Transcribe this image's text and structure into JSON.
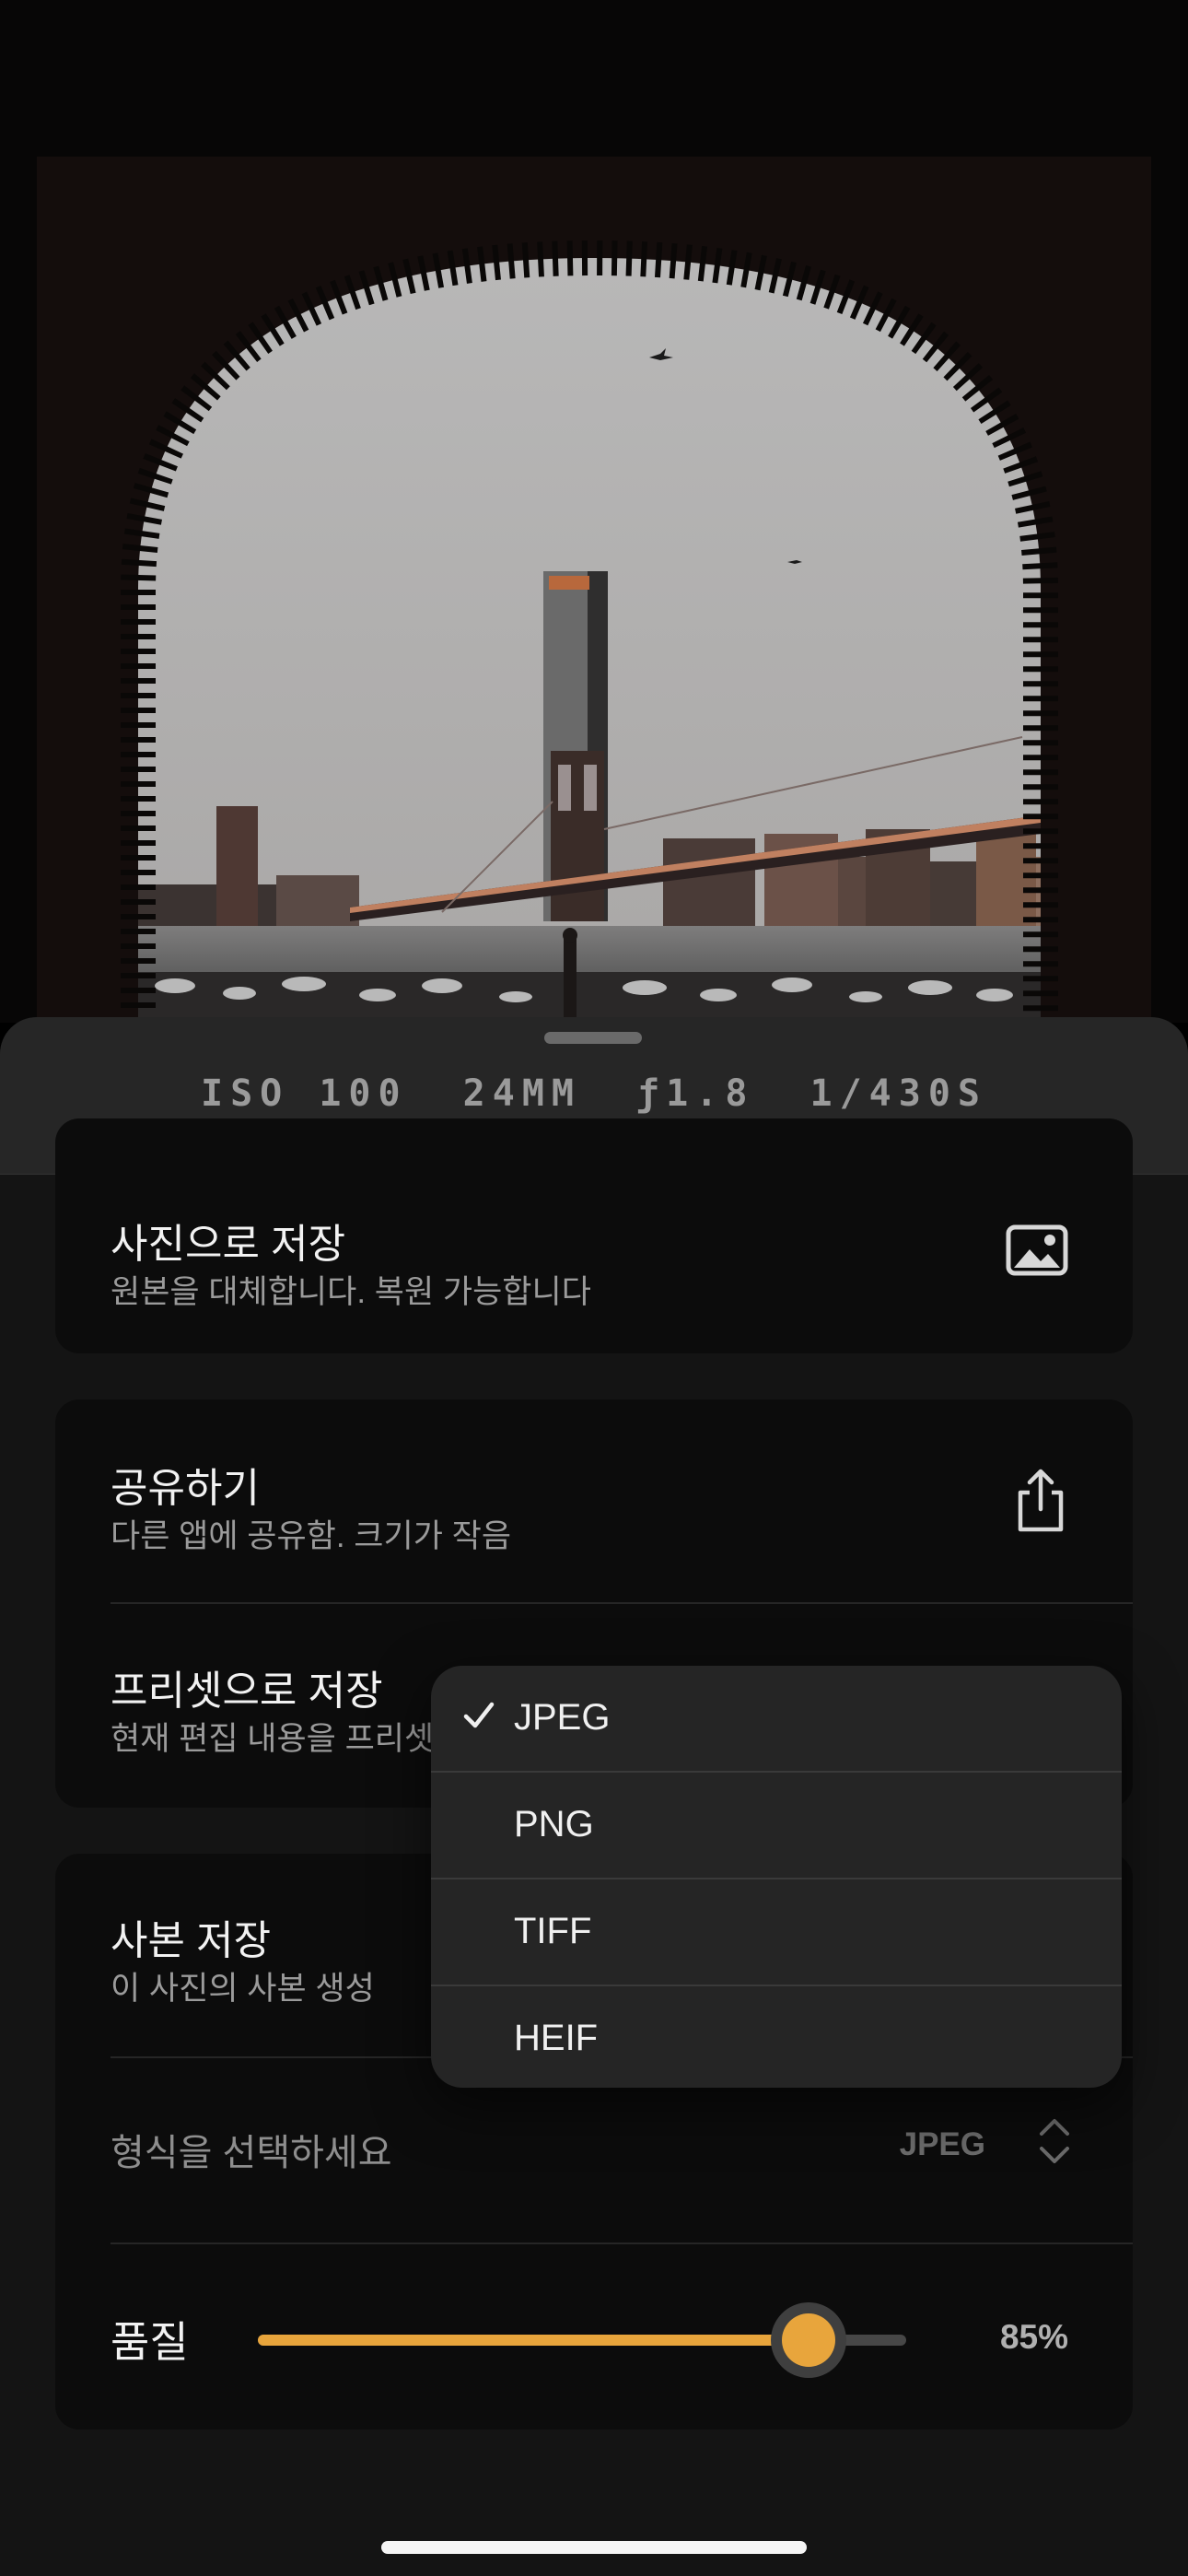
{
  "exif": {
    "iso": "ISO 100",
    "focal": "24MM",
    "aperture": "ƒ1.8",
    "shutter": "1/430S"
  },
  "save_photo": {
    "title": "사진으로 저장",
    "subtitle": "원본을 대체합니다. 복원 가능합니다",
    "icon": "photo-icon"
  },
  "share": {
    "title": "공유하기",
    "subtitle": "다른 앱에 공유함. 크기가 작음",
    "icon": "share-icon"
  },
  "preset": {
    "title": "프리셋으로 저장",
    "subtitle": "현재 편집 내용을 프리셋"
  },
  "copy": {
    "title": "사본 저장",
    "subtitle": "이 사진의 사본 생성"
  },
  "format": {
    "label": "형식을 선택하세요",
    "value": "JPEG",
    "icon": "chevron-updown-icon"
  },
  "quality": {
    "label": "품질",
    "value_text": "85%",
    "value": 0.85
  },
  "format_menu": {
    "selected": "JPEG",
    "options": [
      "JPEG",
      "PNG",
      "TIFF",
      "HEIF"
    ]
  },
  "colors": {
    "accent": "#e8a53c",
    "card": "#0c0c0c",
    "sheet": "#141414",
    "menu": "#252525"
  }
}
